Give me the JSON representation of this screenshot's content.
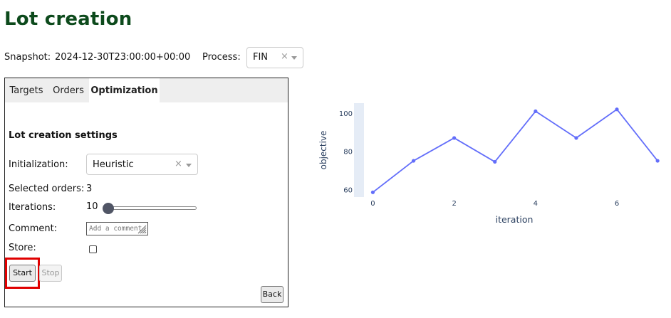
{
  "page": {
    "title": "Lot creation"
  },
  "header": {
    "snapshot_label": "Snapshot:",
    "snapshot_value": "2024-12-30T23:00:00+00:00",
    "process_label": "Process:",
    "process_value": "FIN",
    "process_clear": "×"
  },
  "tabs": [
    {
      "label": "Targets",
      "active": false
    },
    {
      "label": "Orders",
      "active": false
    },
    {
      "label": "Optimization",
      "active": true
    }
  ],
  "settings": {
    "section_title": "Lot creation settings",
    "initialization_label": "Initialization:",
    "initialization_value": "Heuristic",
    "initialization_clear": "×",
    "selected_orders_label": "Selected orders:",
    "selected_orders_value": "3",
    "iterations_label": "Iterations:",
    "iterations_value": "10",
    "iterations_slider_fraction": 0,
    "comment_label": "Comment:",
    "comment_placeholder": "Add a comment",
    "store_label": "Store:",
    "store_checked": false
  },
  "buttons": {
    "start": "Start",
    "stop": "Stop",
    "back": "Back"
  },
  "chart_data": {
    "type": "line",
    "x": [
      0,
      1,
      2,
      3,
      4,
      5,
      6,
      7
    ],
    "y": [
      58.5,
      75,
      87,
      74.5,
      101,
      87,
      102,
      75
    ],
    "xlabel": "iteration",
    "ylabel": "objective",
    "xticks": [
      "0",
      "2",
      "4",
      "6"
    ],
    "yticks": [
      "60",
      "80",
      "100"
    ],
    "xlim": [
      -0.2,
      7.05
    ],
    "ylim": [
      56,
      106
    ],
    "line_color": "#636efa",
    "axis_band_color": "#e5ecf6"
  }
}
